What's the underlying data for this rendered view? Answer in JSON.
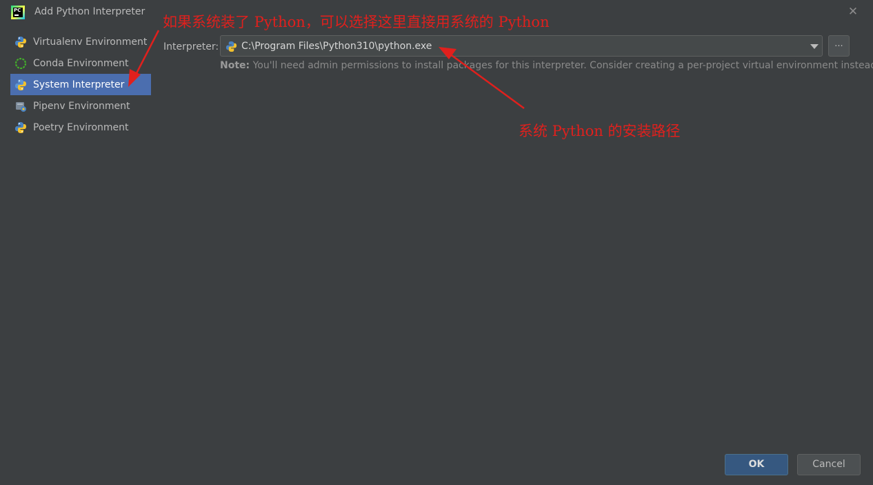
{
  "window": {
    "title": "Add Python Interpreter",
    "close_symbol": "✕",
    "app_icon": "pycharm-logo",
    "app_icon_text": "PC"
  },
  "sidebar": {
    "items": [
      {
        "label": "Virtualenv Environment",
        "icon": "python-icon",
        "selected": false
      },
      {
        "label": "Conda Environment",
        "icon": "conda-icon",
        "selected": false
      },
      {
        "label": "System Interpreter",
        "icon": "python-icon",
        "selected": true
      },
      {
        "label": "Pipenv Environment",
        "icon": "pipenv-icon",
        "selected": false
      },
      {
        "label": "Poetry Environment",
        "icon": "poetry-icon",
        "selected": false
      }
    ]
  },
  "interpreter": {
    "label": "Interpreter:",
    "value": "C:\\Program Files\\Python310\\python.exe",
    "browse_label": "...",
    "note_prefix": "Note:",
    "note_text": " You'll need admin permissions to install packages for this interpreter. Consider creating a per-project virtual environment instead."
  },
  "annotations": {
    "top": "如果系统装了 Python，可以选择这里直接用系统的 Python",
    "path": "系统 Python 的安装路径",
    "color": "#e0201d"
  },
  "buttons": {
    "ok": "OK",
    "cancel": "Cancel"
  },
  "colors": {
    "background": "#3c3f41",
    "selection": "#4b6eaf",
    "ok_button": "#365880"
  }
}
